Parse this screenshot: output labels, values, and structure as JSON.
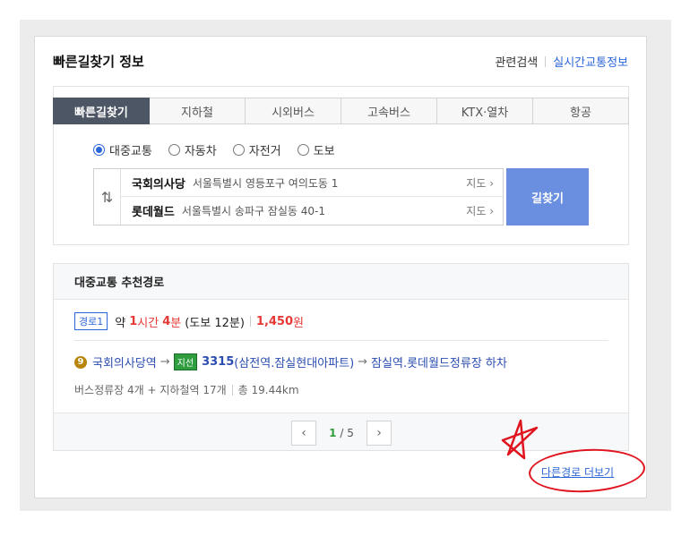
{
  "header": {
    "title": "빠른길찾기 정보",
    "related": "관련검색",
    "traffic": "실시간교통정보"
  },
  "tabs": [
    {
      "label": "빠른길찾기",
      "active": true
    },
    {
      "label": "지하철",
      "active": false
    },
    {
      "label": "시외버스",
      "active": false
    },
    {
      "label": "고속버스",
      "active": false
    },
    {
      "label": "KTX·열차",
      "active": false
    },
    {
      "label": "항공",
      "active": false
    }
  ],
  "modes": [
    {
      "label": "대중교통",
      "checked": true
    },
    {
      "label": "자동차",
      "checked": false
    },
    {
      "label": "자전거",
      "checked": false
    },
    {
      "label": "도보",
      "checked": false
    }
  ],
  "route_form": {
    "swap_glyph": "⇅",
    "origin": {
      "name": "국회의사당",
      "address": "서울특별시 영등포구 여의도동 1",
      "map": "지도 ›"
    },
    "destination": {
      "name": "롯데월드",
      "address": "서울특별시 송파구 잠실동 40-1",
      "map": "지도 ›"
    },
    "find_button": "길찾기"
  },
  "results": {
    "heading": "대중교통 추천경로",
    "route": {
      "badge": "경로1",
      "approx": "약",
      "hours": "1",
      "hour_unit": "시간",
      "minutes": "4",
      "minute_unit": "분",
      "walk": "(도보 12분)",
      "fare": "1,450",
      "fare_unit": "원",
      "line_number": "9",
      "start_station": "국회의사당역",
      "bus_type": "지선",
      "bus_number": "3315",
      "bus_via": "(삼전역.잠실현대아파트)",
      "end_stop": "잠실역.롯데월드정류장 하차",
      "meta_stops": "버스정류장 4개 + 지하철역 17개",
      "meta_total": "총 19.44km"
    },
    "pager": {
      "current": "1",
      "separator": " / ",
      "total": "5"
    }
  },
  "more_link": "다른경로 더보기",
  "colors": {
    "accent_blue": "#2b66d9",
    "find_button": "#6a8fe0",
    "active_tab": "#4c5664",
    "highlight_red": "#e53935",
    "bus_green": "#2e9e3e",
    "annotation_red": "#e0141e"
  }
}
